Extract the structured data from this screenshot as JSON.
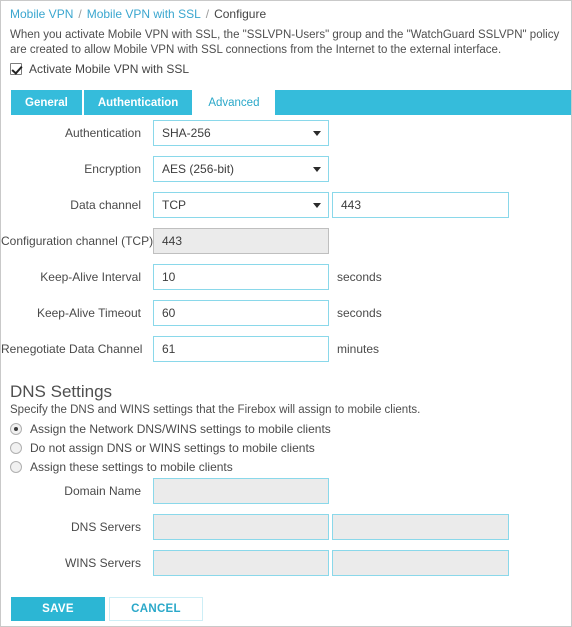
{
  "breadcrumb": {
    "item1": "Mobile VPN",
    "sep1": "/",
    "item2": "Mobile VPN with SSL",
    "sep2": "/",
    "item3": "Configure"
  },
  "description": "When you activate Mobile VPN with SSL, the \"SSLVPN-Users\" group and the \"WatchGuard SSLVPN\" policy are created to allow Mobile VPN with SSL connections from the Internet to the external interface.",
  "activate": {
    "label": "Activate Mobile VPN with SSL",
    "checked": true
  },
  "tabs": [
    {
      "label": "General",
      "active": false
    },
    {
      "label": "Authentication",
      "active": false
    },
    {
      "label": "Advanced",
      "active": true
    }
  ],
  "form": {
    "authentication": {
      "label": "Authentication",
      "value": "SHA-256"
    },
    "encryption": {
      "label": "Encryption",
      "value": "AES (256-bit)"
    },
    "data_channel": {
      "label": "Data channel",
      "protocol": "TCP",
      "port": "443"
    },
    "configuration_channel": {
      "label": "Configuration channel (TCP)",
      "value": "443"
    },
    "keep_alive_interval": {
      "label": "Keep-Alive Interval",
      "value": "10",
      "unit": "seconds"
    },
    "keep_alive_timeout": {
      "label": "Keep-Alive Timeout",
      "value": "60",
      "unit": "seconds"
    },
    "renegotiate_data_channel": {
      "label": "Renegotiate Data Channel",
      "value": "61",
      "unit": "minutes"
    }
  },
  "dns": {
    "heading": "DNS Settings",
    "subtext": "Specify the DNS and WINS settings that the Firebox will assign to mobile clients.",
    "options": [
      {
        "label": "Assign the Network DNS/WINS settings to mobile clients",
        "selected": true
      },
      {
        "label": "Do not assign DNS or WINS settings to mobile clients",
        "selected": false
      },
      {
        "label": "Assign these settings to mobile clients",
        "selected": false
      }
    ],
    "domain_name": {
      "label": "Domain Name",
      "value": ""
    },
    "dns_servers": {
      "label": "DNS Servers",
      "value1": "",
      "value2": ""
    },
    "wins_servers": {
      "label": "WINS Servers",
      "value1": "",
      "value2": ""
    }
  },
  "buttons": {
    "save": "SAVE",
    "cancel": "CANCEL"
  },
  "colors": {
    "accent": "#35bcdb",
    "accent_dark": "#2aa8c9",
    "field_border": "#8ad8ea",
    "disabled_fill": "#ebebeb"
  }
}
